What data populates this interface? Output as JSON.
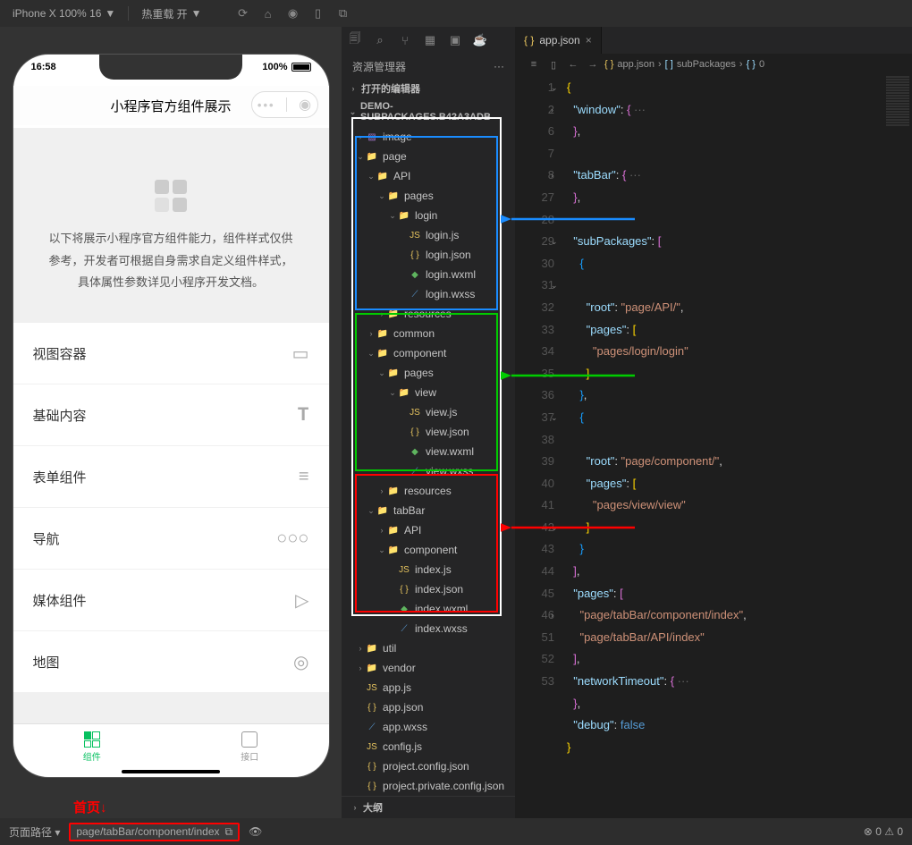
{
  "toolbar": {
    "device": "iPhone X 100% 16",
    "reload": "热重载 开",
    "arrow": "▼"
  },
  "simulator": {
    "time": "16:58",
    "battery": "100%",
    "page_title": "小程序官方组件展示",
    "intro1": "以下将展示小程序官方组件能力，组件样式仅供",
    "intro2": "参考，开发者可根据自身需求自定义组件样式，",
    "intro3": "具体属性参数详见小程序开发文档。",
    "cells": [
      "视图容器",
      "基础内容",
      "表单组件",
      "导航",
      "媒体组件",
      "地图"
    ],
    "tabs": {
      "left": "组件",
      "right": "接口"
    }
  },
  "explorer": {
    "title": "资源管理器",
    "open_editors": "打开的编辑器",
    "project": "DEMO-SUBPACKAGES.B42A3ADB",
    "outline": "大纲",
    "tree": [
      {
        "d": 1,
        "t": "image",
        "i": "img",
        "a": ">"
      },
      {
        "d": 1,
        "t": "page",
        "i": "folder-p",
        "a": "v"
      },
      {
        "d": 2,
        "t": "API",
        "i": "folder-p",
        "a": "v"
      },
      {
        "d": 3,
        "t": "pages",
        "i": "folder-p",
        "a": "v"
      },
      {
        "d": 4,
        "t": "login",
        "i": "folder",
        "a": "v"
      },
      {
        "d": 5,
        "t": "login.js",
        "i": "js"
      },
      {
        "d": 5,
        "t": "login.json",
        "i": "json"
      },
      {
        "d": 5,
        "t": "login.wxml",
        "i": "wxml"
      },
      {
        "d": 5,
        "t": "login.wxss",
        "i": "wxss"
      },
      {
        "d": 3,
        "t": "resources",
        "i": "folder",
        "a": ">"
      },
      {
        "d": 2,
        "t": "common",
        "i": "folder",
        "a": ">"
      },
      {
        "d": 2,
        "t": "component",
        "i": "folder-p",
        "a": "v"
      },
      {
        "d": 3,
        "t": "pages",
        "i": "folder-p",
        "a": "v"
      },
      {
        "d": 4,
        "t": "view",
        "i": "folder-p",
        "a": "v"
      },
      {
        "d": 5,
        "t": "view.js",
        "i": "js"
      },
      {
        "d": 5,
        "t": "view.json",
        "i": "json"
      },
      {
        "d": 5,
        "t": "view.wxml",
        "i": "wxml"
      },
      {
        "d": 5,
        "t": "view.wxss",
        "i": "wxss"
      },
      {
        "d": 3,
        "t": "resources",
        "i": "folder",
        "a": ">"
      },
      {
        "d": 2,
        "t": "tabBar",
        "i": "folder",
        "a": "v"
      },
      {
        "d": 3,
        "t": "API",
        "i": "folder",
        "a": ">"
      },
      {
        "d": 3,
        "t": "component",
        "i": "folder",
        "a": "v"
      },
      {
        "d": 4,
        "t": "index.js",
        "i": "js"
      },
      {
        "d": 4,
        "t": "index.json",
        "i": "json"
      },
      {
        "d": 4,
        "t": "index.wxml",
        "i": "wxml"
      },
      {
        "d": 4,
        "t": "index.wxss",
        "i": "wxss"
      },
      {
        "d": 1,
        "t": "util",
        "i": "folder",
        "a": ">"
      },
      {
        "d": 1,
        "t": "vendor",
        "i": "folder",
        "a": ">"
      },
      {
        "d": 1,
        "t": "app.js",
        "i": "js"
      },
      {
        "d": 1,
        "t": "app.json",
        "i": "json"
      },
      {
        "d": 1,
        "t": "app.wxss",
        "i": "wxss"
      },
      {
        "d": 1,
        "t": "config.js",
        "i": "js"
      },
      {
        "d": 1,
        "t": "project.config.json",
        "i": "json"
      },
      {
        "d": 1,
        "t": "project.private.config.json",
        "i": "json"
      }
    ]
  },
  "editor": {
    "tab": "app.json",
    "breadcrumb": [
      "app.json",
      "subPackages",
      "0"
    ],
    "lines": [
      {
        "n": 1,
        "html": "<span class='brace'>{</span>"
      },
      {
        "n": 2,
        "html": "  <span class='key'>\"window\"</span><span class='pun'>: </span><span class='brace2'>{</span><span class='dim'> ···</span>"
      },
      {
        "n": 6,
        "html": "  <span class='brace2'>}</span><span class='pun'>,</span>"
      },
      {
        "n": 7,
        "html": ""
      },
      {
        "n": 8,
        "html": "  <span class='key'>\"tabBar\"</span><span class='pun'>: </span><span class='brace2'>{</span><span class='dim'> ···</span>"
      },
      {
        "n": 27,
        "html": "  <span class='brace2'>}</span><span class='pun'>,</span>"
      },
      {
        "n": 28,
        "html": ""
      },
      {
        "n": 29,
        "html": "  <span class='key'>\"subPackages\"</span><span class='pun'>: </span><span class='brace2'>[</span>"
      },
      {
        "n": "",
        "html": "    <span class='brace3'>{</span>"
      },
      {
        "n": 30,
        "html": ""
      },
      {
        "n": "",
        "html": "      <span class='key'>\"root\"</span><span class='pun'>: </span><span class='str'>\"page/API/\"</span><span class='pun'>,</span>"
      },
      {
        "n": 31,
        "html": "      <span class='key'>\"pages\"</span><span class='pun'>: </span><span class='brace'>[</span>"
      },
      {
        "n": 32,
        "html": "        <span class='str'>\"pages/login/login\"</span>"
      },
      {
        "n": 33,
        "html": "      <span class='brace'>]</span>"
      },
      {
        "n": 34,
        "html": "    <span class='brace3'>}</span><span class='pun'>,</span>"
      },
      {
        "n": 35,
        "html": "    <span class='brace3'>{</span>"
      },
      {
        "n": 36,
        "html": ""
      },
      {
        "n": "",
        "html": "      <span class='key'>\"root\"</span><span class='pun'>: </span><span class='str'>\"page/component/\"</span><span class='pun'>,</span>"
      },
      {
        "n": 37,
        "html": "      <span class='key'>\"pages\"</span><span class='pun'>: </span><span class='brace'>[</span>"
      },
      {
        "n": 38,
        "html": "        <span class='str'>\"pages/view/view\"</span>"
      },
      {
        "n": 39,
        "html": "      <span class='brace'>]</span>"
      },
      {
        "n": 40,
        "html": "    <span class='brace3'>}</span>"
      },
      {
        "n": 41,
        "html": "  <span class='brace2'>]</span><span class='pun'>,</span>"
      },
      {
        "n": 42,
        "html": "  <span class='key'>\"pages\"</span><span class='pun'>: </span><span class='brace2'>[</span>"
      },
      {
        "n": 43,
        "html": "    <span class='str'>\"page/tabBar/component/index\"</span><span class='pun'>,</span>"
      },
      {
        "n": 44,
        "html": "    <span class='str'>\"page/tabBar/API/index\"</span>"
      },
      {
        "n": 45,
        "html": "  <span class='brace2'>]</span><span class='pun'>,</span>"
      },
      {
        "n": 46,
        "html": "  <span class='key'>\"networkTimeout\"</span><span class='pun'>: </span><span class='brace2'>{</span><span class='dim'> ···</span>"
      },
      {
        "n": 51,
        "html": "  <span class='brace2'>}</span><span class='pun'>,</span>"
      },
      {
        "n": 52,
        "html": "  <span class='key'>\"debug\"</span><span class='pun'>: </span><span class='bool'>false</span>"
      },
      {
        "n": 53,
        "html": "<span class='brace'>}</span>"
      }
    ]
  },
  "statusbar": {
    "path_label": "页面路径",
    "path_value": "page/tabBar/component/index",
    "home_label": "首页↓",
    "errors": "0",
    "warnings": "0"
  }
}
